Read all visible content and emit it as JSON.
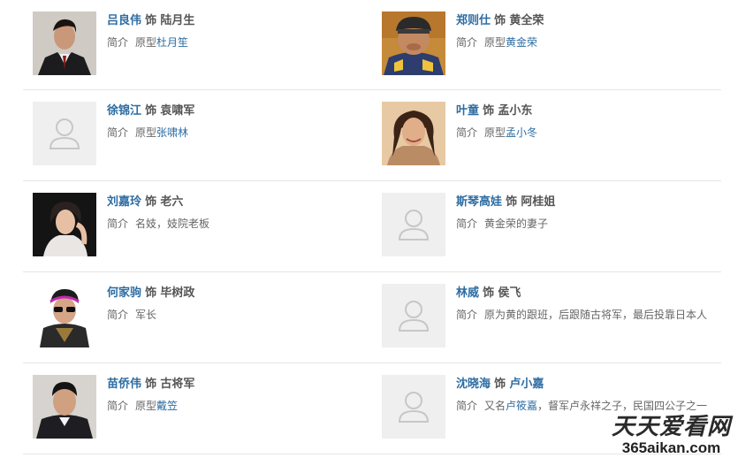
{
  "labels": {
    "shi": "饰",
    "intro": "简介"
  },
  "cast": [
    {
      "actor": "吕良伟",
      "role": "陆月生",
      "intro_prefix": "原型",
      "intro_link": "杜月笙",
      "intro_rest": "",
      "photo": "portrait-dark-suit"
    },
    {
      "actor": "郑则仕",
      "role": "黄全荣",
      "intro_prefix": "原型",
      "intro_link": "黄金荣",
      "intro_rest": "",
      "photo": "portrait-cap"
    },
    {
      "actor": "徐锦江",
      "role": "袁啸军",
      "intro_prefix": "原型",
      "intro_link": "张啸林",
      "intro_rest": "",
      "photo": "placeholder"
    },
    {
      "actor": "叶童",
      "role": "孟小东",
      "intro_prefix": "原型",
      "intro_link": "孟小冬",
      "intro_rest": "",
      "photo": "portrait-woman"
    },
    {
      "actor": "刘嘉玲",
      "role": "老六",
      "intro_prefix": "名妓，妓院老板",
      "intro_link": "",
      "intro_rest": "",
      "photo": "portrait-woman-dark"
    },
    {
      "actor": "斯琴高娃",
      "role": "阿桂姐",
      "intro_prefix": "黄金荣的妻子",
      "intro_link": "",
      "intro_rest": "",
      "photo": "placeholder"
    },
    {
      "actor": "何家驹",
      "role": "毕树政",
      "intro_prefix": "军长",
      "intro_link": "",
      "intro_rest": "",
      "photo": "portrait-sunglasses"
    },
    {
      "actor": "林威",
      "role": "侯飞",
      "intro_prefix": "原为黄的跟班，后跟随古将军，最后投靠日本人",
      "intro_link": "",
      "intro_rest": "",
      "photo": "placeholder"
    },
    {
      "actor": "苗侨伟",
      "role": "古将军",
      "intro_prefix": "原型",
      "intro_link": "戴笠",
      "intro_rest": "",
      "photo": "portrait-man-suit"
    },
    {
      "actor": "沈晓海",
      "role": "卢小嘉",
      "intro_prefix": "又名",
      "intro_link": "卢筱嘉",
      "intro_rest": "，督军卢永祥之子，民国四公子之一",
      "photo": "placeholder"
    }
  ],
  "watermark": {
    "top": "天天爱看网",
    "bottom": "365aikan.com"
  }
}
